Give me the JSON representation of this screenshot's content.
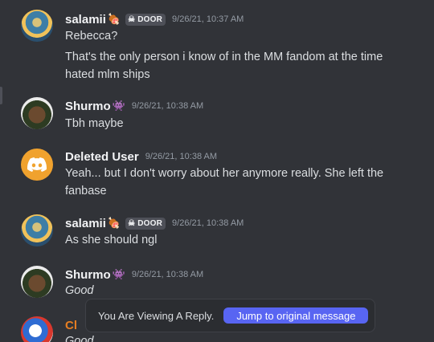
{
  "badge": {
    "label": "DOOR",
    "icon": "skull-icon"
  },
  "messages": [
    {
      "username": "salamii",
      "emoji": "🍖",
      "timestamp": "9/26/21, 10:37 AM",
      "lines": [
        "Rebecca?",
        "That's the only person i know of in the MM fandom at the time hated mlm ships"
      ]
    },
    {
      "username": "Shurmo",
      "emoji": "👾",
      "timestamp": "9/26/21, 10:38 AM",
      "lines": [
        "Tbh maybe"
      ]
    },
    {
      "username": "Deleted User",
      "timestamp": "9/26/21, 10:38 AM",
      "lines": [
        "Yeah... but I don't worry about her anymore really. She left the fanbase"
      ]
    },
    {
      "username": "salamii",
      "emoji": "🍖",
      "timestamp": "9/26/21, 10:38 AM",
      "lines": [
        "As she should ngl"
      ]
    },
    {
      "username": "Shurmo",
      "emoji": "👾",
      "timestamp": "9/26/21, 10:38 AM",
      "lines": [
        "Good"
      ]
    },
    {
      "username": "Cl",
      "lines": [
        "Good"
      ]
    }
  ],
  "reply_bar": {
    "label": "You Are Viewing A Reply.",
    "button": "Jump to original message"
  },
  "colors": {
    "background": "#313338",
    "accent": "#5865f2",
    "deleted_avatar": "#f0a22e"
  }
}
